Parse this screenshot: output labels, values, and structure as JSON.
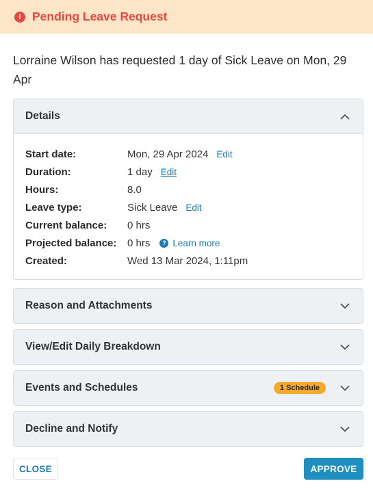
{
  "banner": {
    "icon": "exclamation-icon",
    "icon_glyph": "!",
    "title": "Pending Leave Request",
    "color": "#e5483e",
    "background": "#fde5c7"
  },
  "summary": "Lorraine Wilson has requested 1 day of Sick Leave on Mon, 29 Apr",
  "details": {
    "title": "Details",
    "rows": {
      "start_date": {
        "label": "Start date:",
        "value": "Mon, 29 Apr 2024",
        "link": "Edit"
      },
      "duration": {
        "label": "Duration:",
        "value": "1 day",
        "link": "Edit"
      },
      "hours": {
        "label": "Hours:",
        "value": "8.0"
      },
      "leave_type": {
        "label": "Leave type:",
        "value": "Sick Leave",
        "link": "Edit"
      },
      "current_balance": {
        "label": "Current balance:",
        "value": "0 hrs"
      },
      "projected_balance": {
        "label": "Projected balance:",
        "value": "0 hrs",
        "help_glyph": "?",
        "link": "Learn more"
      },
      "created": {
        "label": "Created:",
        "value": "Wed 13 Mar 2024, 1:11pm"
      }
    }
  },
  "sections": {
    "reason": {
      "title": "Reason and Attachments"
    },
    "breakdown": {
      "title": "View/Edit Daily Breakdown"
    },
    "events": {
      "title": "Events and Schedules",
      "badge": "1 Schedule"
    },
    "decline": {
      "title": "Decline and Notify"
    }
  },
  "footer": {
    "close_label": "CLOSE",
    "approve_label": "APPROVE"
  },
  "colors": {
    "accent": "#1a7bb0",
    "approve": "#1e8fbf",
    "badge": "#f5a92d",
    "panel": "#eef1f4"
  }
}
